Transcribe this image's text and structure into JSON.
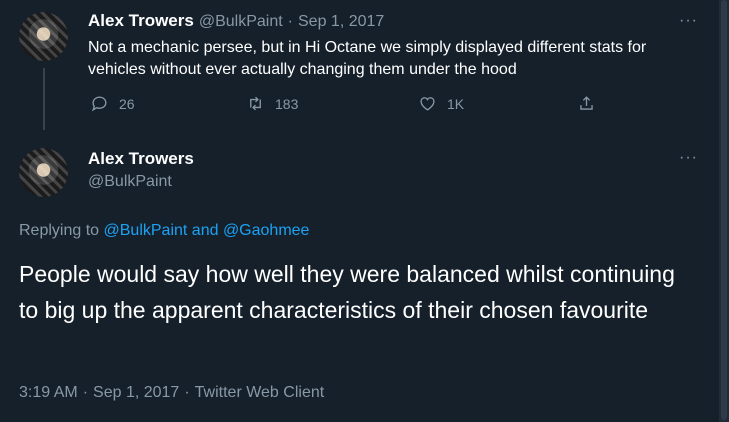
{
  "tweet1": {
    "name": "Alex Trowers",
    "handle": "@BulkPaint",
    "separator": "·",
    "date": "Sep 1, 2017",
    "text": "Not a mechanic persee, but in Hi Octane we simply displayed different stats for vehicles without ever actually changing them under the hood",
    "replies": "26",
    "retweets": "183",
    "likes": "1K",
    "more": "···"
  },
  "tweet2": {
    "name": "Alex Trowers",
    "handle": "@BulkPaint",
    "more": "···",
    "replying_prefix": "Replying to ",
    "replying_user1": "@BulkPaint",
    "replying_and": " and ",
    "replying_user2": "@Gaohmee",
    "text": "People would say how well they were balanced whilst continuing to big up the apparent characteristics of their chosen favourite",
    "time": "3:19 AM",
    "separator": "·",
    "date": "Sep 1, 2017",
    "client": "Twitter Web Client"
  },
  "icons": [
    "reply-icon",
    "retweet-icon",
    "like-icon",
    "share-icon",
    "more-icon"
  ],
  "colors": {
    "background": "#15202b",
    "text": "#ffffff",
    "muted": "#8899a6",
    "link": "#1da1f2",
    "line": "#38444d"
  }
}
